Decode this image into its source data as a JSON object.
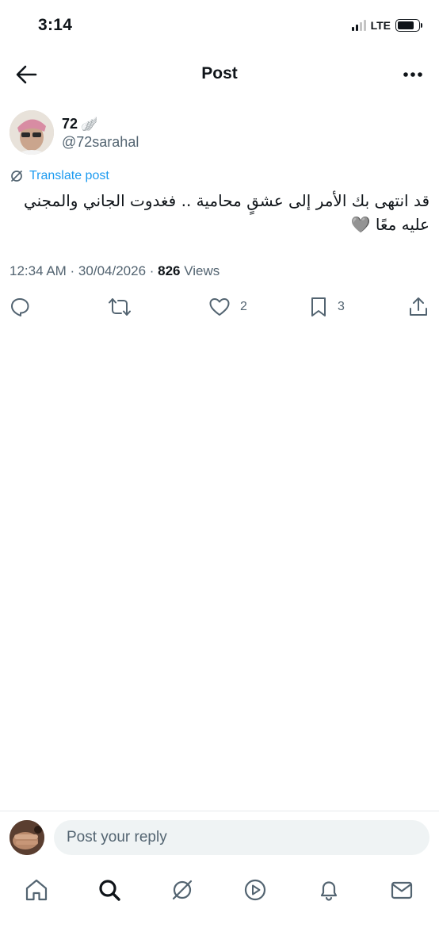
{
  "status_bar": {
    "time": "3:14",
    "network": "LTE",
    "signal_bars_active": 2,
    "battery_level": 0.8
  },
  "header": {
    "title": "Post",
    "back_icon": "arrow-left-icon",
    "more_icon": "more-horizontal-icon"
  },
  "post": {
    "author": {
      "display_name": "72",
      "name_emoji": "🪽",
      "handle": "@72sarahal"
    },
    "translate_label": "Translate post",
    "text_line1": "قد انتهى بك الأمر إلى عشقٍ محامية .. فغدوت الجاني والمجني",
    "text_line2": "عليه معًا 🩶",
    "timestamp": "12:34 AM · 30/04/2026 · ",
    "views_count": "826",
    "views_label": " Views",
    "actions": {
      "reply_icon": "reply-icon",
      "repost_icon": "repost-icon",
      "like_icon": "heart-icon",
      "like_count": "2",
      "bookmark_icon": "bookmark-icon",
      "bookmark_count": "3",
      "share_icon": "share-icon"
    }
  },
  "reply_bar": {
    "placeholder": "Post your reply"
  },
  "bottom_nav": {
    "items": [
      "home-icon",
      "search-icon",
      "grok-icon",
      "video-icon",
      "notifications-icon",
      "messages-icon"
    ]
  },
  "colors": {
    "text_primary": "#0f1419",
    "text_secondary": "#536471",
    "accent": "#1d9bf0",
    "input_bg": "#eff3f4"
  }
}
